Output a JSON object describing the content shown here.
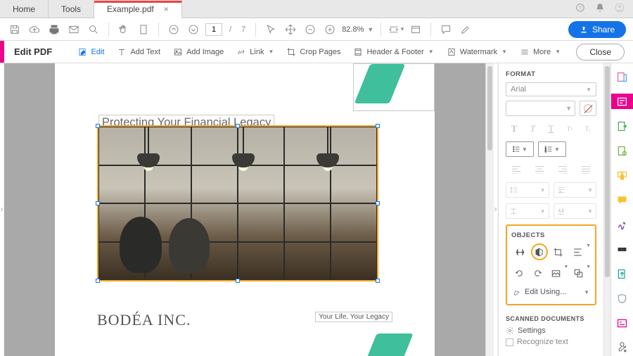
{
  "tabs": {
    "home": "Home",
    "tools": "Tools",
    "file": "Example.pdf"
  },
  "toolbar": {
    "page_current": "1",
    "page_total": "7",
    "page_sep": "/",
    "zoom": "82.8%",
    "share": "Share"
  },
  "editbar": {
    "title": "Edit PDF",
    "edit": "Edit",
    "add_text": "Add Text",
    "add_image": "Add Image",
    "link": "Link",
    "crop": "Crop Pages",
    "header_footer": "Header & Footer",
    "watermark": "Watermark",
    "more": "More",
    "close": "Close"
  },
  "document": {
    "heading": "Protecting Your Financial Legacy",
    "tagline": "Your Life, Your Legacy",
    "brand": "BODÉA INC."
  },
  "format": {
    "title": "FORMAT",
    "font": "Arial",
    "styles": {
      "bold": "T",
      "italic": "T",
      "underline": "T",
      "super": "T",
      "sub": "T"
    },
    "objects_title": "OBJECTS",
    "edit_using": "Edit Using...",
    "scanned_title": "SCANNED DOCUMENTS",
    "settings": "Settings",
    "recognize": "Recognize text"
  }
}
